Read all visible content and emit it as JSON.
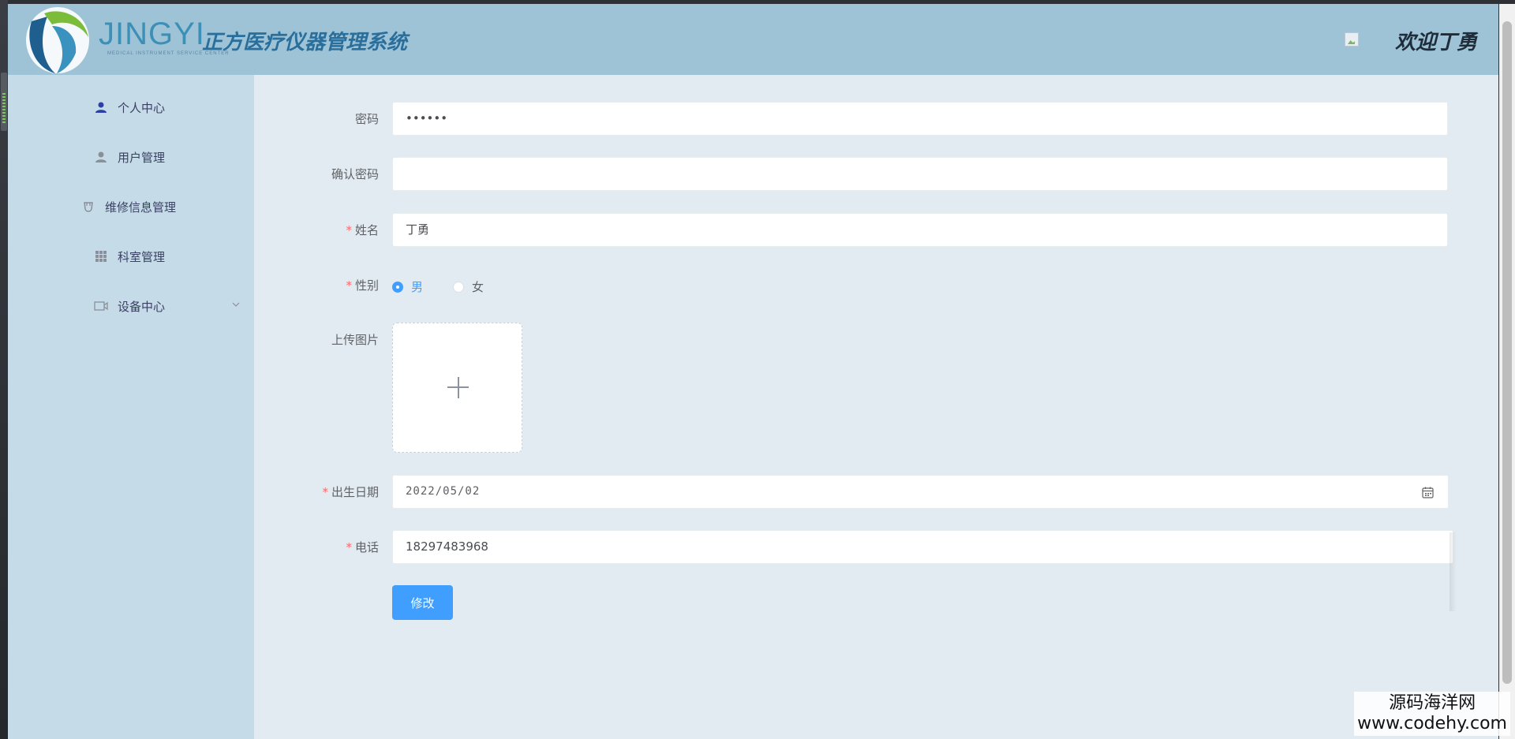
{
  "header": {
    "logo_text": "JINGYI",
    "logo_subtext": "MEDICAL INSTRUMENT SERVICE CENTER",
    "system_title": "正方医疗仪器管理系统",
    "welcome": "欢迎丁勇",
    "avatar_icon": "broken-image-icon"
  },
  "sidebar": {
    "items": [
      {
        "label": "个人中心",
        "icon": "user-icon"
      },
      {
        "label": "用户管理",
        "icon": "users-icon"
      },
      {
        "label": "维修信息管理",
        "icon": "repair-icon"
      },
      {
        "label": "科室管理",
        "icon": "grid-icon"
      },
      {
        "label": "设备中心",
        "icon": "device-icon"
      }
    ]
  },
  "form": {
    "password": {
      "label": "密码",
      "value": "••••••"
    },
    "confirm_password": {
      "label": "确认密码",
      "value": ""
    },
    "name": {
      "label": "姓名",
      "value": "丁勇",
      "required": "*"
    },
    "gender": {
      "label": "性别",
      "required": "*",
      "options": [
        "男",
        "女"
      ],
      "selected": "男"
    },
    "upload": {
      "label": "上传图片",
      "icon": "plus-icon"
    },
    "birthday": {
      "label": "出生日期",
      "value": "2022/05/02",
      "required": "*",
      "icon": "calendar-icon"
    },
    "phone": {
      "label": "电话",
      "value": "18297483968",
      "required": "*"
    },
    "submit_label": "修改"
  },
  "watermark": {
    "line1": "源码海洋网",
    "line2": "www.codehy.com"
  },
  "colors": {
    "header_bg": "#9ec3d7",
    "sidebar_bg": "#c5dbe7",
    "content_bg": "#e1ebf1",
    "primary": "#409eff",
    "required": "#f56c6c"
  }
}
